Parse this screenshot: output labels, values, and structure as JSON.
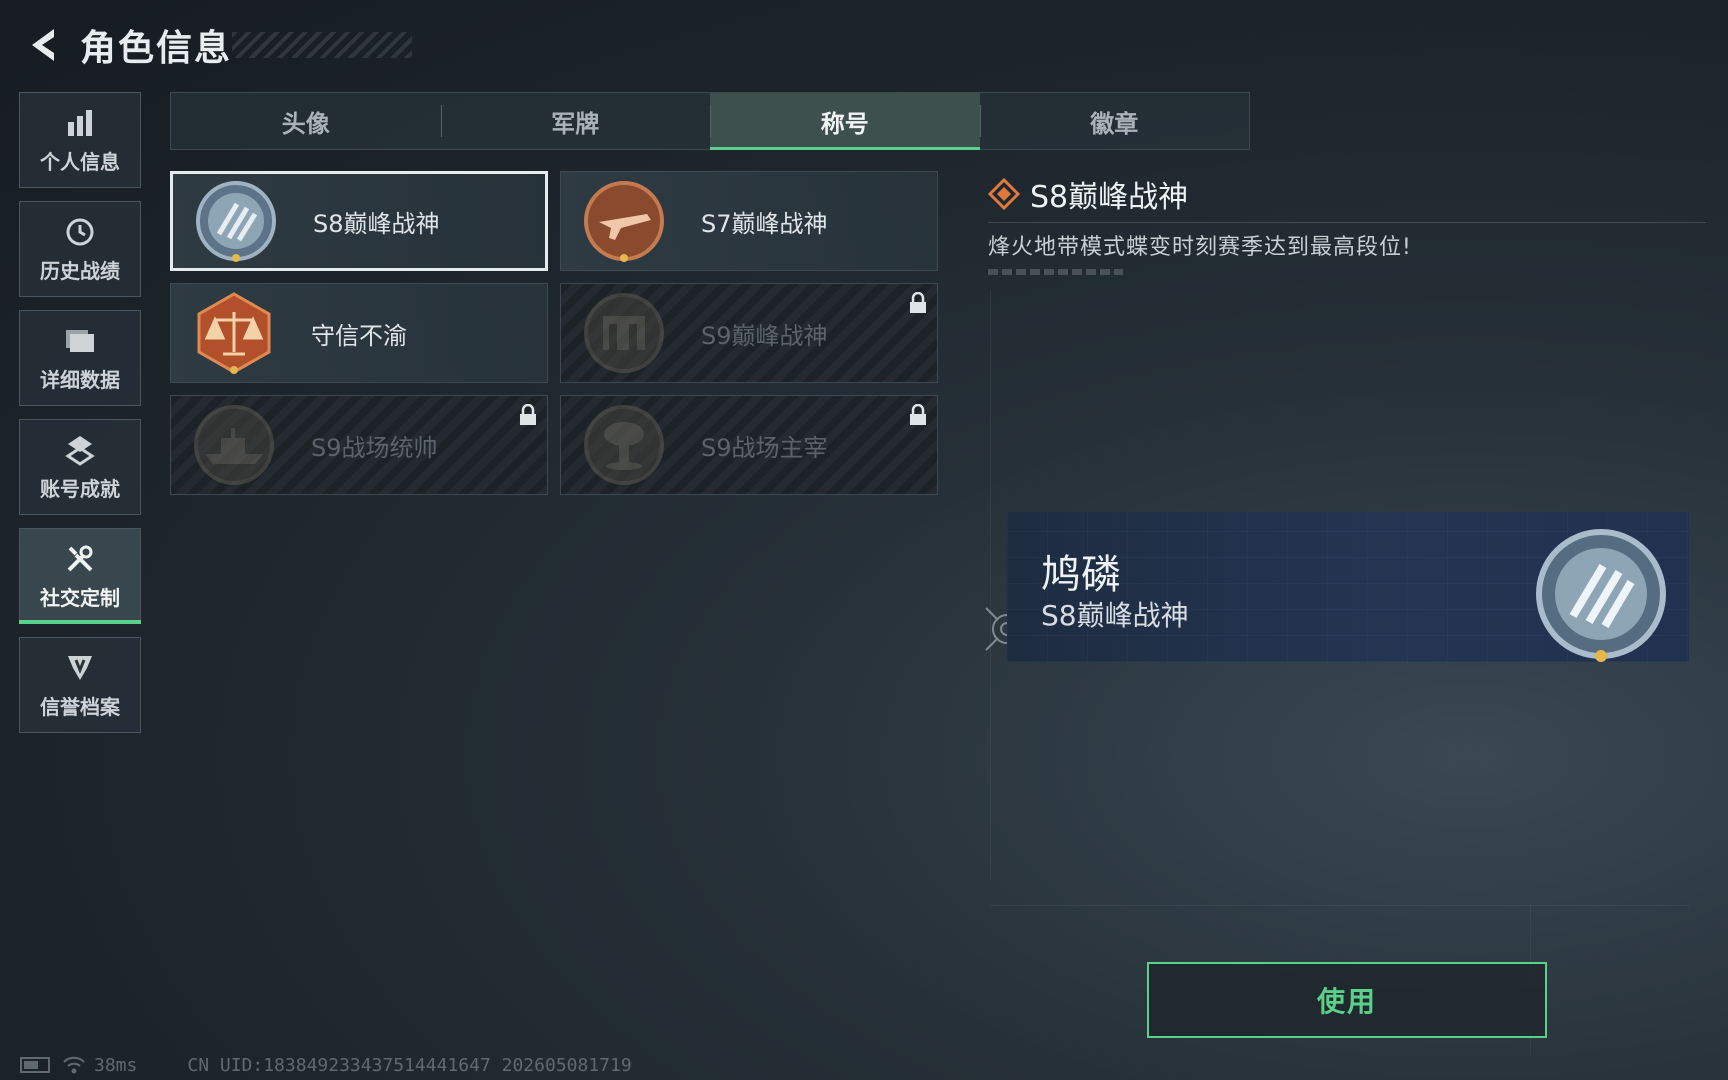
{
  "header": {
    "title": "角色信息"
  },
  "sidebar": {
    "items": [
      {
        "label": "个人信息",
        "icon": "bar-chart-icon"
      },
      {
        "label": "历史战绩",
        "icon": "history-clock-icon"
      },
      {
        "label": "详细数据",
        "icon": "folder-icon"
      },
      {
        "label": "账号成就",
        "icon": "achievement-medal-icon"
      },
      {
        "label": "社交定制",
        "icon": "tools-icon",
        "active": true
      },
      {
        "label": "信誉档案",
        "icon": "credit-shield-icon"
      }
    ]
  },
  "tabs": [
    {
      "label": "头像"
    },
    {
      "label": "军牌"
    },
    {
      "label": "称号",
      "active": true
    },
    {
      "label": "徽章"
    }
  ],
  "titles": [
    {
      "name": "S8巅峰战神",
      "locked": false,
      "selected": true,
      "badge": "steel-wing-emblem"
    },
    {
      "name": "S7巅峰战神",
      "locked": false,
      "selected": false,
      "badge": "rifle-emblem"
    },
    {
      "name": "守信不渝",
      "locked": false,
      "selected": false,
      "badge": "scales-emblem"
    },
    {
      "name": "S9巅峰战神",
      "locked": true,
      "selected": false,
      "badge": "building-emblem"
    },
    {
      "name": "S9战场统帅",
      "locked": true,
      "selected": false,
      "badge": "warship-emblem"
    },
    {
      "name": "S9战场主宰",
      "locked": true,
      "selected": false,
      "badge": "mushroom-cloud-emblem"
    }
  ],
  "detail": {
    "title": "S8巅峰战神",
    "description": "烽火地带模式蝶变时刻赛季达到最高段位!"
  },
  "preview": {
    "player_name": "鸠磷",
    "title": "S8巅峰战神"
  },
  "use_button": {
    "label": "使用"
  },
  "status": {
    "ping": "38ms",
    "uid": "CN UID:183849233437514441647 202605081719"
  },
  "colors": {
    "accent": "#5bd08a",
    "badge_orange": "#e07a3c"
  }
}
